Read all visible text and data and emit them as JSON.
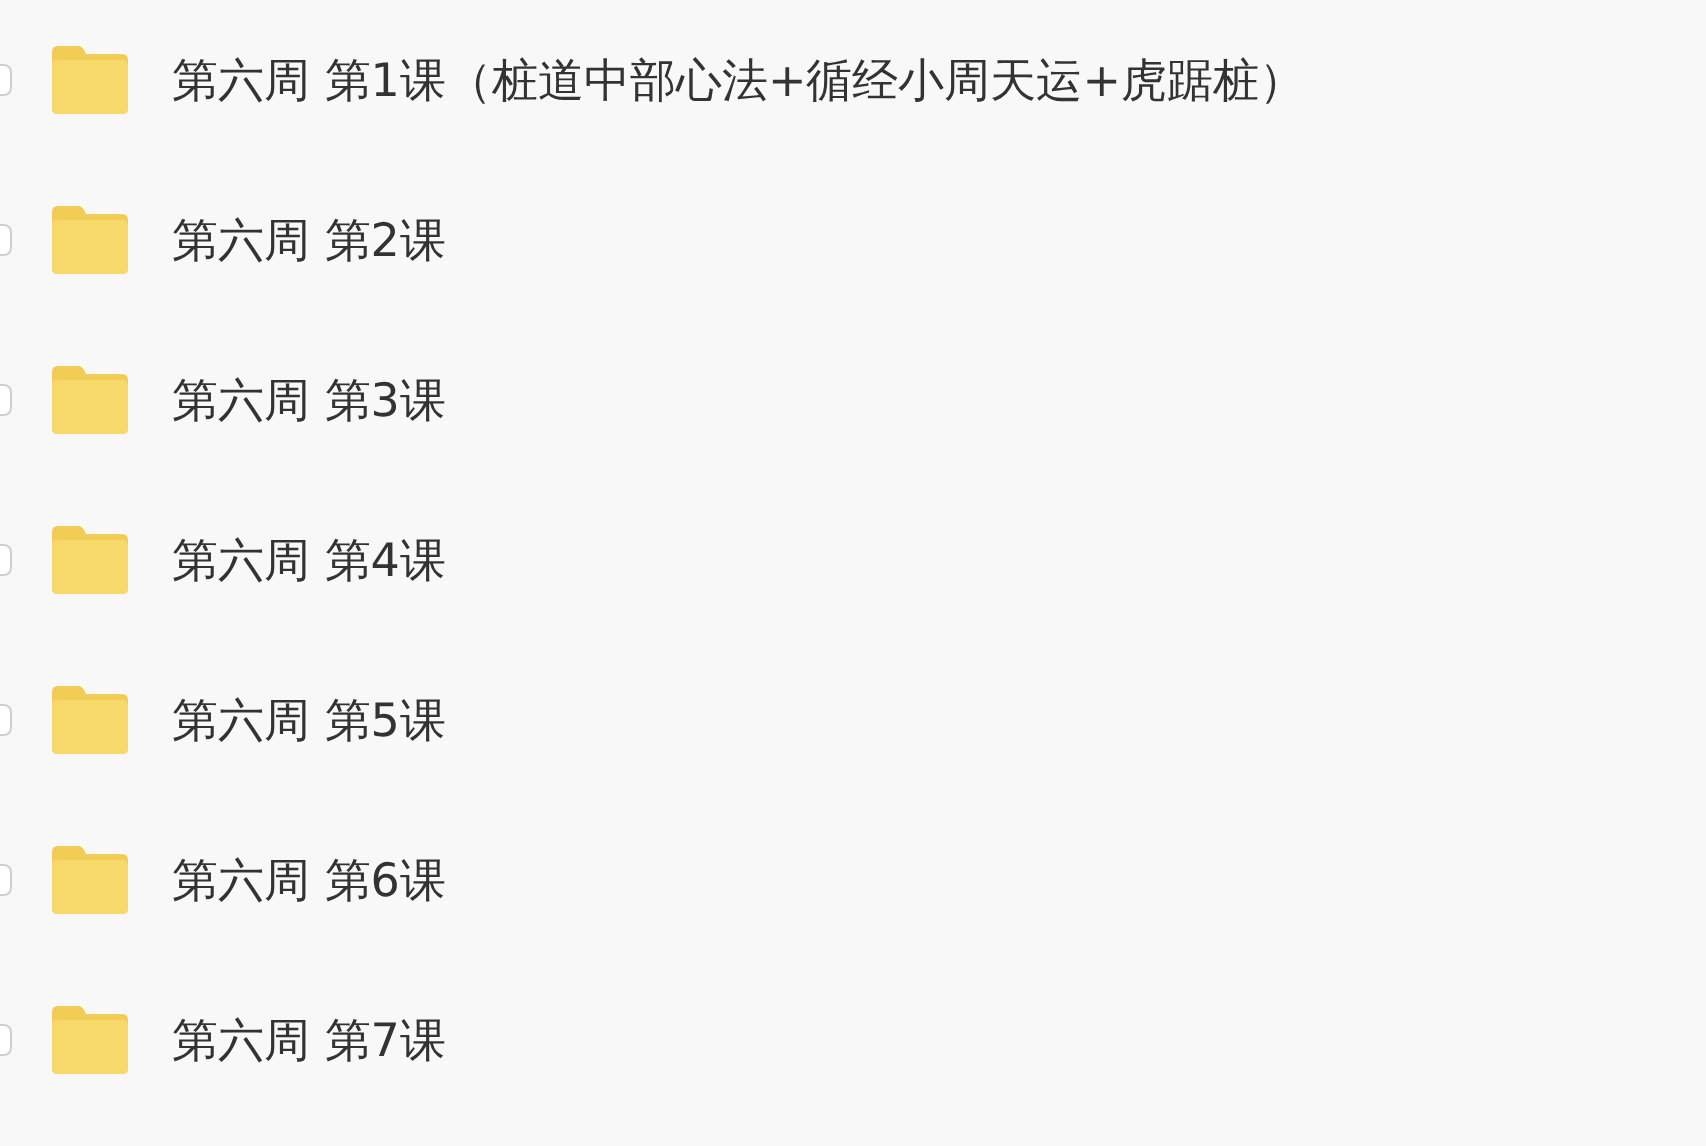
{
  "folders": [
    {
      "name": "第六周 第1课（桩道中部心法+循经小周天运+虎踞桩）",
      "checked": false
    },
    {
      "name": "第六周 第2课",
      "checked": false
    },
    {
      "name": "第六周 第3课",
      "checked": false
    },
    {
      "name": "第六周 第4课",
      "checked": false
    },
    {
      "name": "第六周 第5课",
      "checked": false
    },
    {
      "name": "第六周 第6课",
      "checked": false
    },
    {
      "name": "第六周 第7课",
      "checked": false
    }
  ]
}
